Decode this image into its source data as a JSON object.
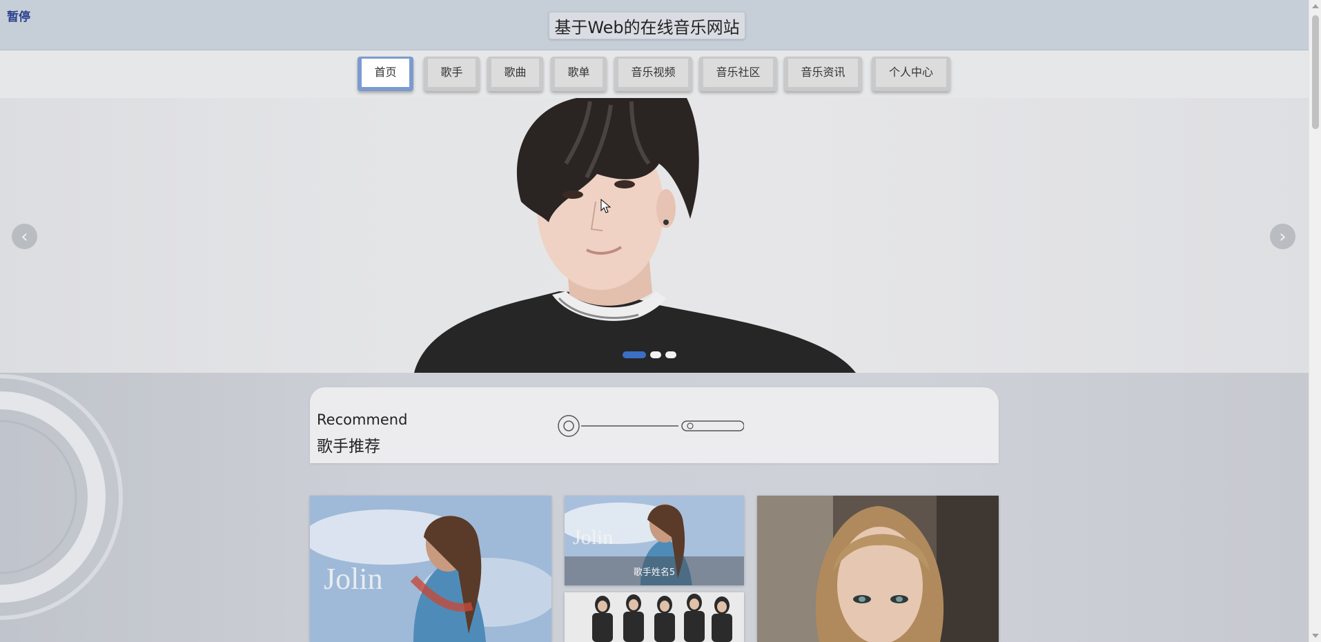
{
  "header": {
    "pause_label": "暂停",
    "site_title": "基于Web的在线音乐网站"
  },
  "nav": {
    "items": [
      {
        "label": "首页",
        "active": true
      },
      {
        "label": "歌手"
      },
      {
        "label": "歌曲"
      },
      {
        "label": "歌单"
      },
      {
        "label": "音乐视频"
      },
      {
        "label": "音乐社区"
      },
      {
        "label": "音乐资讯"
      },
      {
        "label": "个人中心"
      }
    ]
  },
  "carousel": {
    "prev_icon": "chevron-left-icon",
    "next_icon": "chevron-right-icon",
    "prev_glyph": "‹",
    "next_glyph": "›",
    "slide_count": 3,
    "active_slide": 1
  },
  "recommend": {
    "title_en": "Recommend",
    "title_cn": "歌手推荐"
  },
  "singers": {
    "caption_5": "歌手姓名5"
  },
  "colors": {
    "accent": "#3a6fc4",
    "nav_active_border": "#7b9bcf",
    "pause_text": "#2b3f8c"
  }
}
